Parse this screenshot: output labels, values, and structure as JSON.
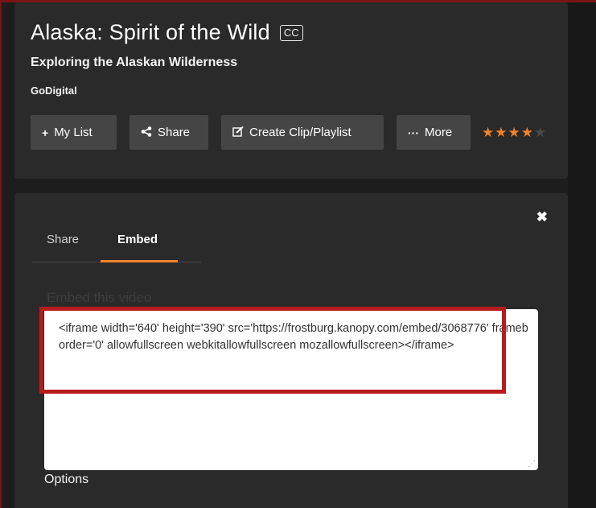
{
  "video": {
    "title": "Alaska: Spirit of the Wild",
    "cc_badge": "CC",
    "subtitle": "Exploring the Alaskan Wilderness",
    "provider": "GoDigital"
  },
  "actions": {
    "my_list_icon": "+",
    "my_list_label": "My List",
    "share_icon": "share-icon",
    "share_label": "Share",
    "clip_icon": "edit-icon",
    "clip_label": "Create Clip/Playlist",
    "more_icon": "ellipsis-icon",
    "more_label": "More"
  },
  "rating": {
    "value": 4,
    "max": 5,
    "color_on": "#f0832a",
    "color_off": "#4a4a4a"
  },
  "panel": {
    "close_icon": "close-icon",
    "tabs": [
      {
        "label": "Share",
        "active": false
      },
      {
        "label": "Embed",
        "active": true
      }
    ],
    "embed_label": "Embed this video",
    "embed_code": "<iframe width='640' height='390' src='https://frostburg.kanopy.com/embed/3068776' frameborder='0' allowfullscreen webkitallowfullscreen mozallowfullscreen></iframe>",
    "options_label": "Options"
  },
  "colors": {
    "accent": "#f0832a",
    "highlight": "#b71c1c"
  }
}
